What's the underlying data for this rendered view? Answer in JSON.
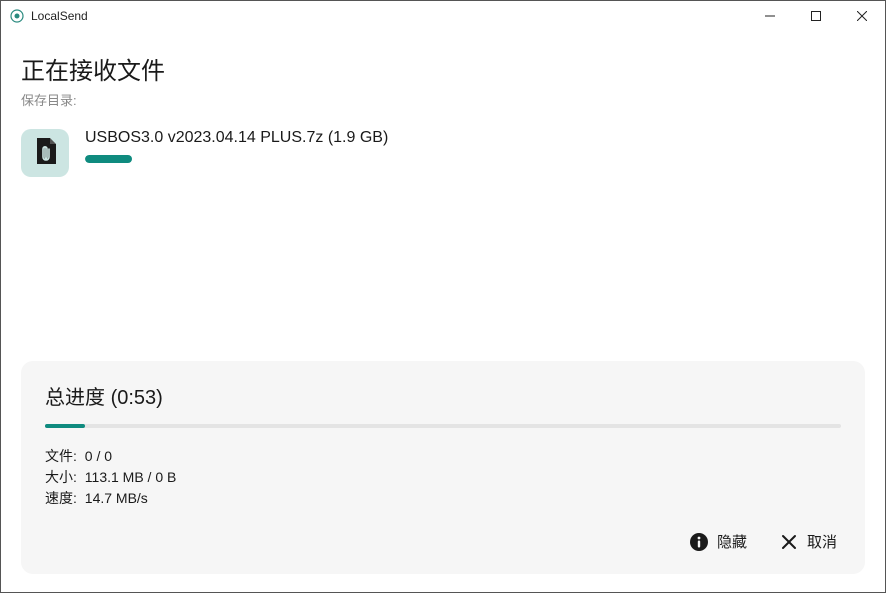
{
  "window": {
    "title": "LocalSend"
  },
  "header": {
    "title": "正在接收文件",
    "save_dir_label": "保存目录:"
  },
  "file": {
    "name": "USBOS3.0 v2023.04.14 PLUS.7z (1.9 GB)",
    "progress_percent": 6,
    "icon_name": "attachment-file-icon"
  },
  "total": {
    "title_prefix": "总进度",
    "elapsed": "(0:53)",
    "progress_percent": 5,
    "stats": {
      "files_label": "文件:",
      "files_value": "0 / 0",
      "size_label": "大小:",
      "size_value": "113.1 MB / 0 B",
      "speed_label": "速度:",
      "speed_value": "14.7 MB/s"
    }
  },
  "actions": {
    "hide_label": "隐藏",
    "cancel_label": "取消"
  },
  "colors": {
    "accent": "#0f8b7f",
    "panel_bg": "#f6f6f6",
    "icon_bg": "#cce5e2"
  }
}
